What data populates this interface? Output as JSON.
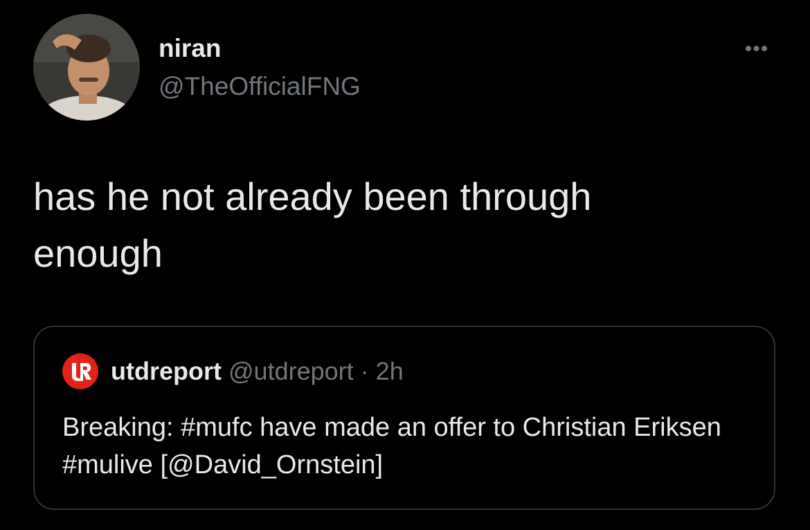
{
  "tweet": {
    "author": {
      "display_name": "niran",
      "handle": "@TheOfficialFNG"
    },
    "more_label": "•••",
    "text": "has he not already been through\nenough"
  },
  "quoted_tweet": {
    "author": {
      "display_name": "utdreport",
      "handle": "@utdreport"
    },
    "separator": "·",
    "time": "2h",
    "text": "Breaking: #mufc have made an offer to Christian Eriksen #mulive [@David_Ornstein]"
  },
  "colors": {
    "background": "#000000",
    "primary_text": "#e7e9ea",
    "secondary_text": "#71767b",
    "border": "#2f3336",
    "logo_red": "#e2231a"
  }
}
